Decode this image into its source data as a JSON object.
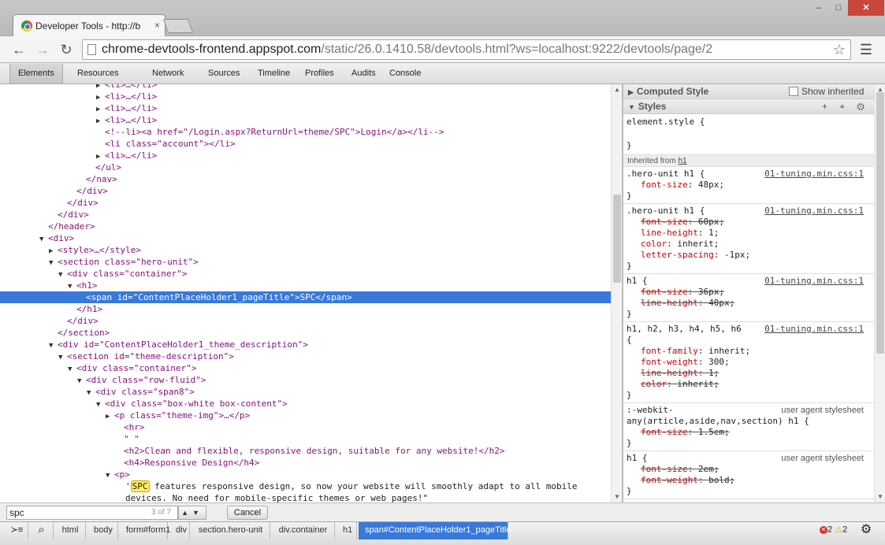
{
  "window": {
    "tab_title": "Developer Tools - http://b",
    "tab_close": "×",
    "min": "–",
    "max": "□",
    "close": "✕"
  },
  "toolbar": {
    "back": "←",
    "forward": "→",
    "reload": "↻",
    "url_host": "chrome-devtools-frontend.appspot.com",
    "url_path": "/static/26.0.1410.58/devtools.html?ws=localhost:9222/devtools/page/2",
    "star": "☆",
    "menu": "☰"
  },
  "devtools_tabs": [
    "Elements",
    "Resources",
    "Network",
    "Sources",
    "Timeline",
    "Profiles",
    "Audits",
    "Console"
  ],
  "dom_lines": [
    {
      "arrow": "▶",
      "text": "<li>…</li>",
      "indent": 10
    },
    {
      "arrow": "▶",
      "text": "<li>…</li>",
      "indent": 10
    },
    {
      "arrow": "▶",
      "text": "<li>…</li>",
      "indent": 10
    },
    {
      "arrow": "▶",
      "text": "<li>…</li>",
      "indent": 10
    },
    {
      "arrow": "",
      "text": "<!--li><a href=\"/Login.aspx?ReturnUrl=theme/SPC\">Login</a></li-->",
      "indent": 10
    },
    {
      "arrow": "",
      "text": "<li class=\"account\"></li>",
      "indent": 10
    },
    {
      "arrow": "▶",
      "text": "<li>…</li>",
      "indent": 10
    },
    {
      "arrow": "",
      "text": "</ul>",
      "indent": 9
    },
    {
      "arrow": "",
      "text": "</nav>",
      "indent": 8
    },
    {
      "arrow": "",
      "text": "</div>",
      "indent": 7
    },
    {
      "arrow": "",
      "text": "</div>",
      "indent": 6
    },
    {
      "arrow": "",
      "text": "</div>",
      "indent": 5
    },
    {
      "arrow": "",
      "text": "</header>",
      "indent": 4
    },
    {
      "arrow": "▼",
      "text": "<div>",
      "indent": 4
    },
    {
      "arrow": "▶",
      "text": "<style>…</style>",
      "indent": 5
    },
    {
      "arrow": "▼",
      "text": "<section class=\"hero-unit\">",
      "indent": 5
    },
    {
      "arrow": "▼",
      "text": "<div class=\"container\">",
      "indent": 6
    },
    {
      "arrow": "▼",
      "text": "<h1>",
      "indent": 7
    },
    {
      "arrow": "",
      "text": "<span id=\"ContentPlaceHolder1_pageTitle\">SPC</span>",
      "indent": 8
    },
    {
      "arrow": "",
      "text": "</h1>",
      "indent": 7
    },
    {
      "arrow": "",
      "text": "</div>",
      "indent": 6
    },
    {
      "arrow": "",
      "text": "</section>",
      "indent": 5
    },
    {
      "arrow": "▼",
      "text": "<div id=\"ContentPlaceHolder1_theme_description\">",
      "indent": 5
    },
    {
      "arrow": "▼",
      "text": "<section id=\"theme-description\">",
      "indent": 6
    },
    {
      "arrow": "▼",
      "text": "<div class=\"container\">",
      "indent": 7
    },
    {
      "arrow": "▼",
      "text": "<div class=\"row-fluid\">",
      "indent": 8
    },
    {
      "arrow": "▼",
      "text": "<div class=\"span8\">",
      "indent": 9
    },
    {
      "arrow": "▼",
      "text": "<div class=\"box-white box-content\">",
      "indent": 10
    },
    {
      "arrow": "▶",
      "text": "<p class=\"theme-img\">…</p>",
      "indent": 11
    },
    {
      "arrow": "",
      "text": "<hr>",
      "indent": 12
    },
    {
      "arrow": "",
      "text": "\" \"",
      "indent": 12
    },
    {
      "arrow": "",
      "text": "<h2>Clean and flexible, responsive design, suitable for any website!</h2>",
      "indent": 12
    },
    {
      "arrow": "",
      "text": "<h4>Responsive Design</h4>",
      "indent": 12
    },
    {
      "arrow": "▼",
      "text": "<p>",
      "indent": 11
    }
  ],
  "dom_selected_index": 18,
  "dom_text_node": {
    "quote": "'",
    "highlight": "SPC",
    "rest": " features responsive design, so now your website will smoothly adapt to all mobile",
    "line2": "devices. No need for mobile-specific themes or web pages!\""
  },
  "sidebar": {
    "computed_style": "Computed Style",
    "show_inherited": "Show inherited",
    "styles": "Styles",
    "style_icons": "+ ⌖ ⚙",
    "element_style": "element.style {",
    "close_brace": "}",
    "inherited_prefix": "Inherited from ",
    "inherited_from": "h1",
    "rules": [
      {
        "selector": "",
        "selector_line1": ".hero-unit h1 {",
        "source": "01-tuning.min.css:1",
        "props": [
          {
            "name": "font-size",
            "value": "48px;",
            "struck": false
          }
        ]
      },
      {
        "selector_line1": ".hero-unit h1 {",
        "source": "01-tuning.min.css:1",
        "props": [
          {
            "name": "font-size",
            "value": "60px;",
            "struck": true
          },
          {
            "name": "line-height",
            "value": "1;",
            "struck": false
          },
          {
            "name": "color",
            "value": "inherit;",
            "struck": false
          },
          {
            "name": "letter-spacing",
            "value": "-1px;",
            "struck": false
          }
        ]
      },
      {
        "selector_line1": "h1 {",
        "source": "01-tuning.min.css:1",
        "props": [
          {
            "name": "font-size",
            "value": "36px;",
            "struck": true
          },
          {
            "name": "line-height",
            "value": "40px;",
            "struck": true
          }
        ]
      },
      {
        "selector_line1": "h1, h2, h3, h4, h5, h6",
        "selector_line2": "{",
        "source": "01-tuning.min.css:1",
        "props": [
          {
            "name": "font-family",
            "value": "inherit;",
            "struck": false
          },
          {
            "name": "font-weight",
            "value": "300;",
            "struck": false
          },
          {
            "name": "line-height",
            "value": "1;",
            "struck": true
          },
          {
            "name": "color",
            "value": "inherit;",
            "struck": true
          }
        ]
      },
      {
        "selector_line1": ":-webkit-",
        "selector_line2": "any(article,aside,nav,section) h1 {",
        "source": "user agent stylesheet",
        "props": [
          {
            "name": "font-size",
            "value": "1.5em;",
            "struck": true
          }
        ]
      },
      {
        "selector_line1": "h1 {",
        "source": "user agent stylesheet",
        "props": [
          {
            "name": "font-size",
            "value": "2em;",
            "struck": true
          },
          {
            "name": "font-weight",
            "value": "bold;",
            "struck": true
          }
        ]
      }
    ]
  },
  "search": {
    "value": "spc",
    "count": "3 of 7",
    "nav": "▲▼",
    "cancel": "Cancel"
  },
  "status": {
    "console_icon": "≻≡",
    "search_icon": "⌕",
    "breadcrumbs": [
      "html",
      "body",
      "form#form1",
      "div",
      "section.hero-unit",
      "div.container",
      "h1",
      "span#ContentPlaceHolder1_pageTitle"
    ],
    "errors": "2",
    "warnings": "2",
    "warn_glyph": "⚠",
    "gear": "⚙"
  }
}
